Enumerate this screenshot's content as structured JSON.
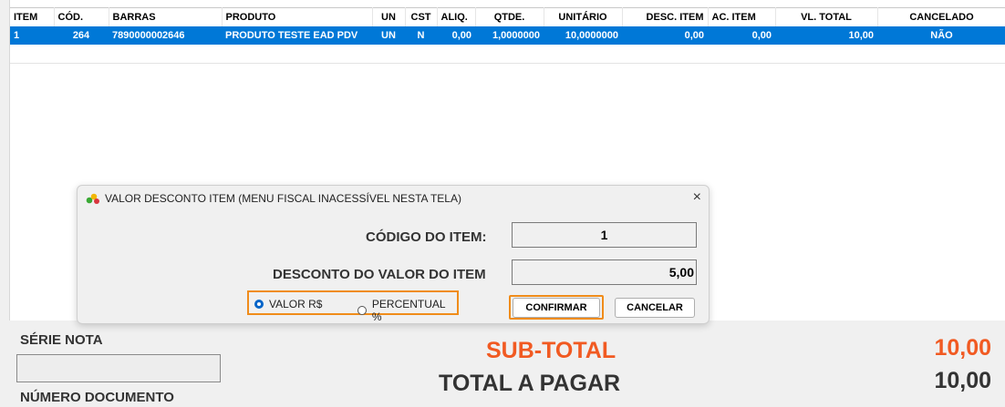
{
  "grid": {
    "headers": [
      "ITEM",
      "CÓD.",
      "BARRAS",
      "PRODUTO",
      "UN",
      "CST",
      "ALIQ.",
      "QTDE.",
      "UNITÁRIO",
      "DESC. ITEM",
      "AC. ITEM",
      "VL. TOTAL",
      "CANCELADO"
    ],
    "rows": [
      [
        "1",
        "264",
        "7890000002646",
        "PRODUTO TESTE EAD PDV",
        "UN",
        "N",
        "0,00",
        "1,0000000",
        "10,0000000",
        "0,00",
        "0,00",
        "10,00",
        "NÃO"
      ]
    ]
  },
  "dialog": {
    "title": "VALOR DESCONTO ITEM (MENU FISCAL INACESSÍVEL NESTA TELA)",
    "close": "×",
    "codigo_label": "CÓDIGO DO ITEM:",
    "codigo_value": "1",
    "desconto_label": "DESCONTO DO VALOR DO ITEM",
    "desconto_value": "5,00",
    "radio_valor": "VALOR R$",
    "radio_percentual": "PERCENTUAL %",
    "selected_mode": "VALOR R$",
    "confirm_label": "CONFIRMAR",
    "cancel_label": "CANCELAR"
  },
  "footer": {
    "serie_label": "SÉRIE NOTA",
    "numero_label": "NÚMERO DOCUMENTO",
    "subtotal_label": "SUB-TOTAL",
    "subtotal_value": "10,00",
    "total_label": "TOTAL A PAGAR",
    "total_value": "10,00"
  },
  "colors": {
    "selection": "#0078d7",
    "highlight": "#f08c1a",
    "subtotal": "#f15a22"
  },
  "icons": [
    "app-icon",
    "close-icon"
  ]
}
